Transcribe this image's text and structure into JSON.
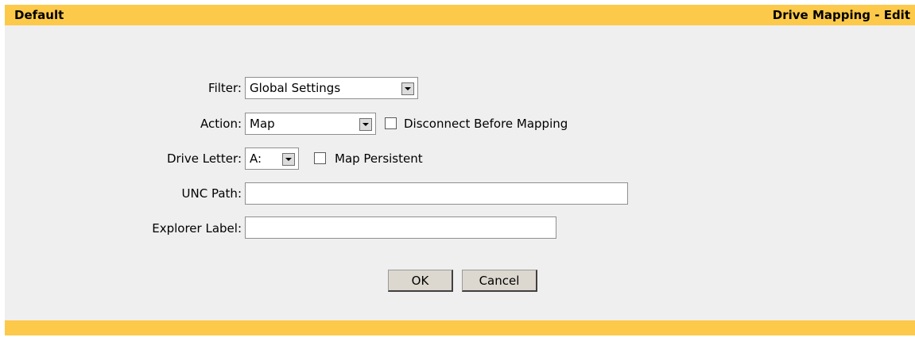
{
  "header": {
    "left_title": "Default",
    "right_title": "Drive Mapping - Edit"
  },
  "form": {
    "filter": {
      "label": "Filter:",
      "value": "Global Settings"
    },
    "action": {
      "label": "Action:",
      "value": "Map",
      "checkbox_label": "Disconnect Before Mapping",
      "checked": false
    },
    "drive_letter": {
      "label": "Drive Letter:",
      "value": "A:",
      "checkbox_label": "Map Persistent",
      "checked": false
    },
    "unc_path": {
      "label": "UNC Path:",
      "value": ""
    },
    "explorer_label": {
      "label": "Explorer Label:",
      "value": ""
    }
  },
  "buttons": {
    "ok": "OK",
    "cancel": "Cancel"
  },
  "colors": {
    "header_bar": "#fcc94a",
    "panel_background": "#efefef"
  },
  "icons": {
    "dropdown": "chevron-down-icon"
  }
}
